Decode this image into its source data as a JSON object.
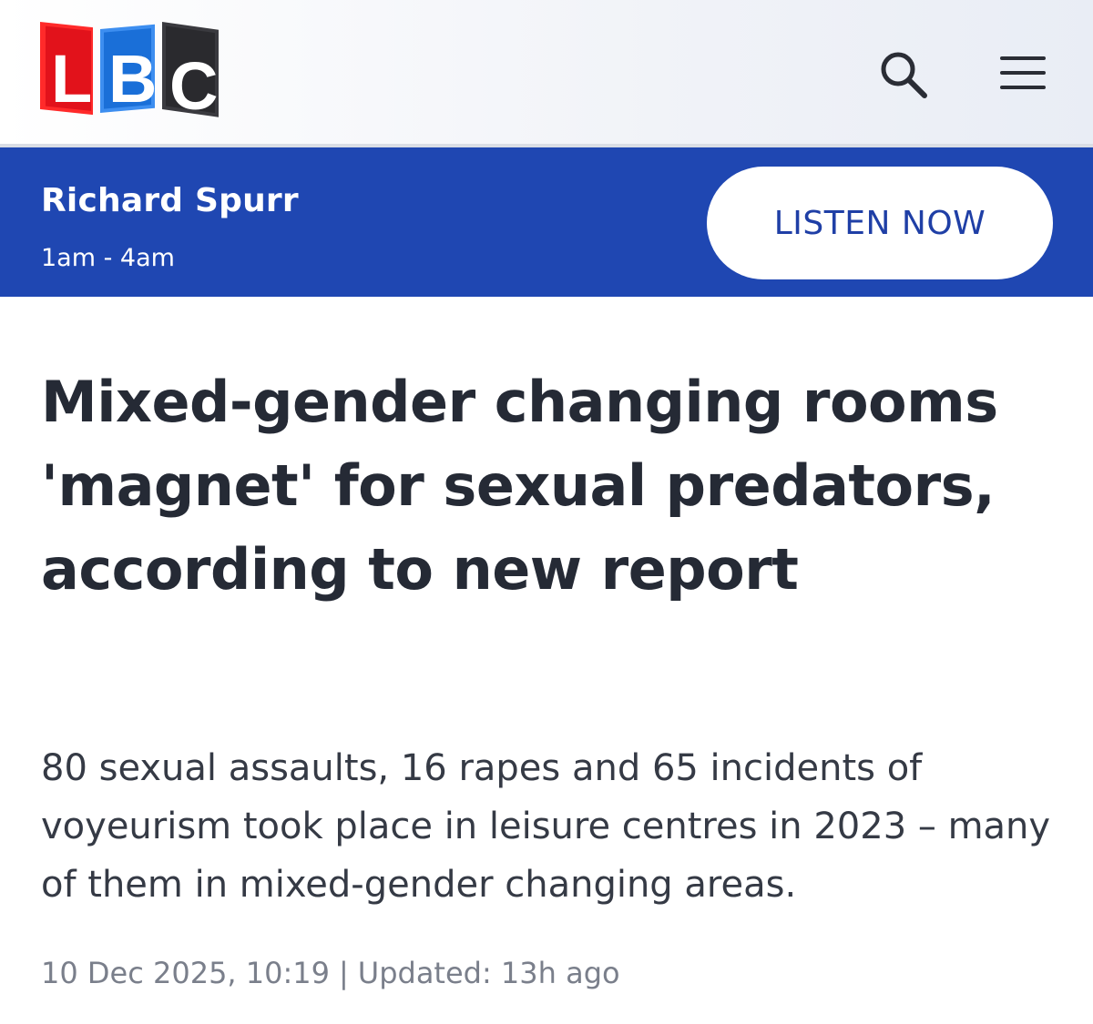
{
  "header": {
    "logo": {
      "letters": [
        "L",
        "B",
        "C"
      ],
      "colors": [
        "#e2121b",
        "#1a6fd8",
        "#2a2a2e"
      ]
    },
    "search_icon": "search-icon",
    "menu_icon": "hamburger-menu-icon"
  },
  "live_bar": {
    "background": "#1f47b2",
    "show_name": "Richard Spurr",
    "show_time": "1am - 4am",
    "listen_label": "LISTEN NOW"
  },
  "article": {
    "headline": "Mixed-gender changing rooms 'magnet' for sexual predators, according to new report",
    "standfirst": "80 sexual assaults, 16 rapes and 65 incidents of voyeurism took place in leisure centres in 2023 – many of them in mixed-gender changing areas.",
    "published": "10 Dec 2025, 10:19",
    "separator": "|",
    "updated": "Updated: 13h ago"
  }
}
